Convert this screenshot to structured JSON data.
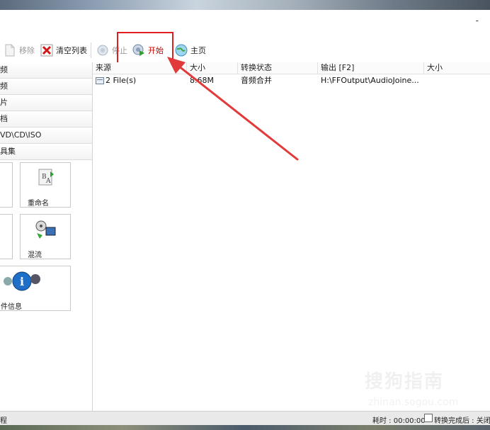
{
  "window": {
    "minimize_label": "-"
  },
  "toolbar": {
    "remove_label": "移除",
    "clear_list_label": "清空列表",
    "stop_label": "停止",
    "start_label": "开始",
    "home_label": "主页"
  },
  "sidebar": {
    "items": [
      {
        "label": "频"
      },
      {
        "label": "频"
      },
      {
        "label": "片"
      },
      {
        "label": "档"
      },
      {
        "label": "VD\\CD\\ISO"
      },
      {
        "label": "具集"
      }
    ],
    "tools": {
      "rename_label": "重命名",
      "mux_label": "混流",
      "file_info_label": "件信息"
    }
  },
  "file_list": {
    "columns": [
      "来源",
      "大小",
      "转换状态",
      "输出 [F2]",
      "大小"
    ],
    "rows": [
      {
        "source": "2 File(s)",
        "size": "8.68M",
        "status": "音频合并",
        "output": "H:\\FFOutput\\AudioJoine...",
        "out_size": ""
      }
    ]
  },
  "statusbar": {
    "left_label": "程",
    "elapsed_label": "耗时 : 00:00:00",
    "after_done_label": "转换完成后 : 关闭"
  },
  "watermark": {
    "text": "搜狗指南",
    "sub": "zhinan.sogou.com"
  },
  "colors": {
    "highlight": "#e02020",
    "start_text": "#c00000"
  }
}
